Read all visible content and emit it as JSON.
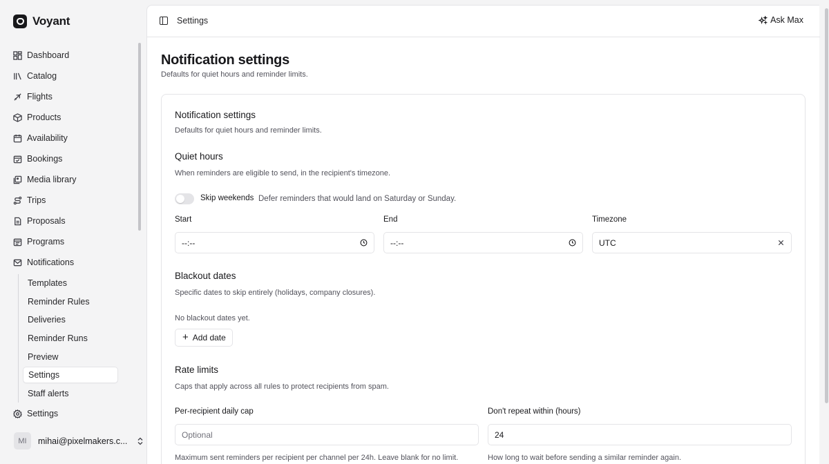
{
  "app": {
    "name": "Voyant"
  },
  "sidebar": {
    "items": [
      {
        "label": "Dashboard",
        "icon": "dashboard-icon"
      },
      {
        "label": "Catalog",
        "icon": "catalog-icon"
      },
      {
        "label": "Flights",
        "icon": "plane-icon"
      },
      {
        "label": "Products",
        "icon": "package-icon"
      },
      {
        "label": "Availability",
        "icon": "calendar-icon"
      },
      {
        "label": "Bookings",
        "icon": "calendar-check-icon"
      },
      {
        "label": "Media library",
        "icon": "images-icon"
      },
      {
        "label": "Trips",
        "icon": "route-icon"
      },
      {
        "label": "Proposals",
        "icon": "file-text-icon"
      },
      {
        "label": "Programs",
        "icon": "calendar-range-icon"
      },
      {
        "label": "Notifications",
        "icon": "mail-icon"
      }
    ],
    "notifications_sub": [
      "Templates",
      "Reminder Rules",
      "Deliveries",
      "Reminder Runs",
      "Preview",
      "Settings",
      "Staff alerts"
    ],
    "active_sub": "Settings",
    "settings_label": "Settings",
    "user": {
      "initials": "MI",
      "email": "mihai@pixelmakers.c..."
    }
  },
  "topbar": {
    "breadcrumb": "Settings",
    "ask_label": "Ask Max"
  },
  "page": {
    "title": "Notification settings",
    "subtitle": "Defaults for quiet hours and reminder limits."
  },
  "card": {
    "title": "Notification settings",
    "subtitle": "Defaults for quiet hours and reminder limits.",
    "quiet_hours": {
      "title": "Quiet hours",
      "desc": "When reminders are eligible to send, in the recipient's timezone.",
      "skip_weekends": {
        "label": "Skip weekends",
        "desc": "Defer reminders that would land on Saturday or Sunday.",
        "on": false
      },
      "start": {
        "label": "Start",
        "value": "--:--"
      },
      "end": {
        "label": "End",
        "value": "--:--"
      },
      "timezone": {
        "label": "Timezone",
        "value": "UTC"
      }
    },
    "blackout": {
      "title": "Blackout dates",
      "desc": "Specific dates to skip entirely (holidays, company closures).",
      "empty": "No blackout dates yet.",
      "add_label": "Add date"
    },
    "rate_limits": {
      "title": "Rate limits",
      "desc": "Caps that apply across all rules to protect recipients from spam.",
      "daily_cap": {
        "label": "Per-recipient daily cap",
        "placeholder": "Optional",
        "value": "",
        "help": "Maximum sent reminders per recipient per channel per 24h. Leave blank for no limit."
      },
      "repeat_within": {
        "label": "Don't repeat within (hours)",
        "value": "24",
        "help": "How long to wait before sending a similar reminder again."
      }
    }
  }
}
